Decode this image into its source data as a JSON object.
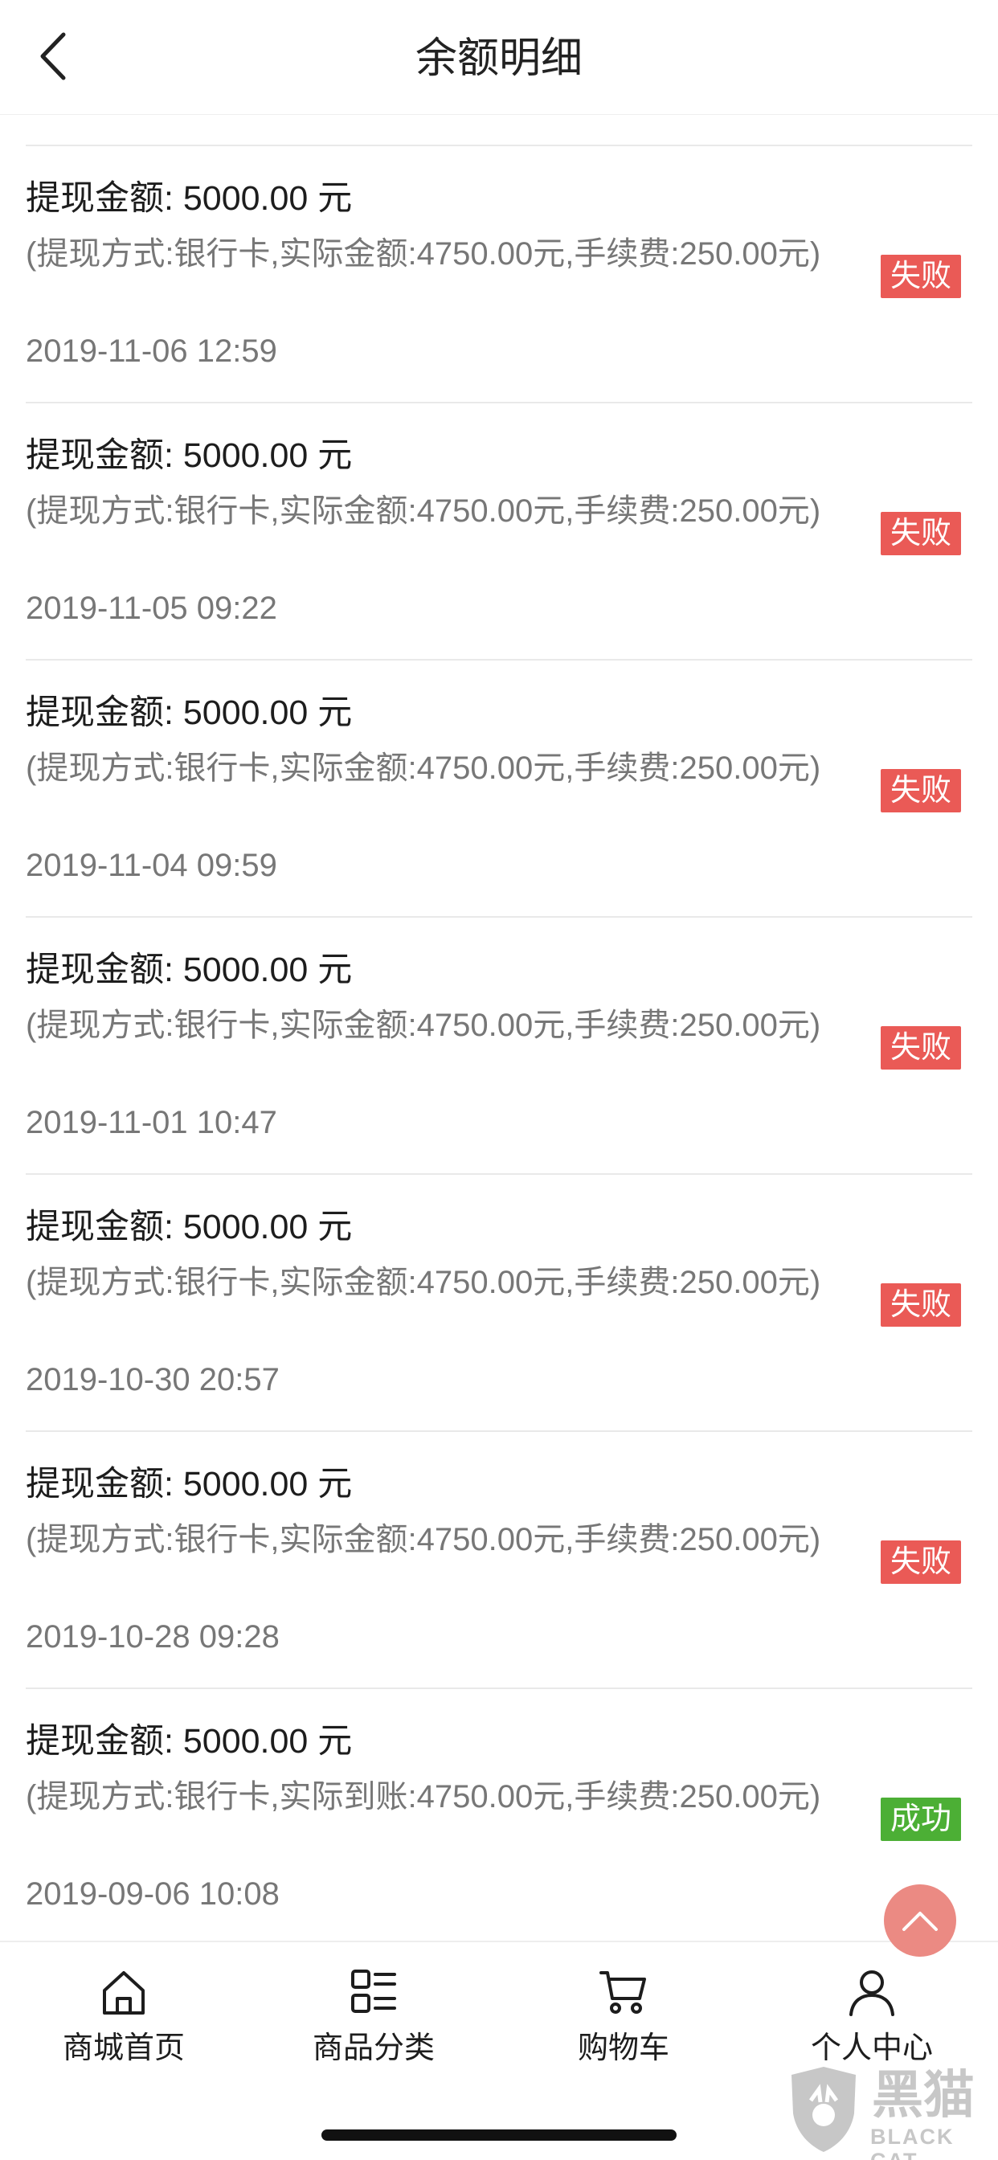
{
  "header": {
    "title": "余额明细"
  },
  "records": [
    {
      "amount": "提现金额: 5000.00 元",
      "detail": "(提现方式:银行卡,实际金额:4750.00元,手续费:250.00元)",
      "time": "2019-11-06 12:59",
      "status": "失败"
    },
    {
      "amount": "提现金额: 5000.00 元",
      "detail": "(提现方式:银行卡,实际金额:4750.00元,手续费:250.00元)",
      "time": "2019-11-05 09:22",
      "status": "失败"
    },
    {
      "amount": "提现金额: 5000.00 元",
      "detail": "(提现方式:银行卡,实际金额:4750.00元,手续费:250.00元)",
      "time": "2019-11-04 09:59",
      "status": "失败"
    },
    {
      "amount": "提现金额: 5000.00 元",
      "detail": "(提现方式:银行卡,实际金额:4750.00元,手续费:250.00元)",
      "time": "2019-11-01 10:47",
      "status": "失败"
    },
    {
      "amount": "提现金额: 5000.00 元",
      "detail": "(提现方式:银行卡,实际金额:4750.00元,手续费:250.00元)",
      "time": "2019-10-30 20:57",
      "status": "失败"
    },
    {
      "amount": "提现金额: 5000.00 元",
      "detail": "(提现方式:银行卡,实际金额:4750.00元,手续费:250.00元)",
      "time": "2019-10-28 09:28",
      "status": "失败"
    },
    {
      "amount": "提现金额: 5000.00 元",
      "detail": "(提现方式:银行卡,实际到账:4750.00元,手续费:250.00元)",
      "time": "2019-09-06 10:08",
      "status": "成功"
    }
  ],
  "tabbar": {
    "items": [
      {
        "label": "商城首页",
        "icon": "home-icon"
      },
      {
        "label": "商品分类",
        "icon": "category-icon"
      },
      {
        "label": "购物车",
        "icon": "cart-icon"
      },
      {
        "label": "个人中心",
        "icon": "user-icon"
      }
    ]
  },
  "watermark": {
    "cn": "黑猫",
    "en": "BLACK CAT"
  },
  "colors": {
    "fail": "#ea5a56",
    "success": "#4caf35",
    "to_top": "#eb8a83"
  }
}
